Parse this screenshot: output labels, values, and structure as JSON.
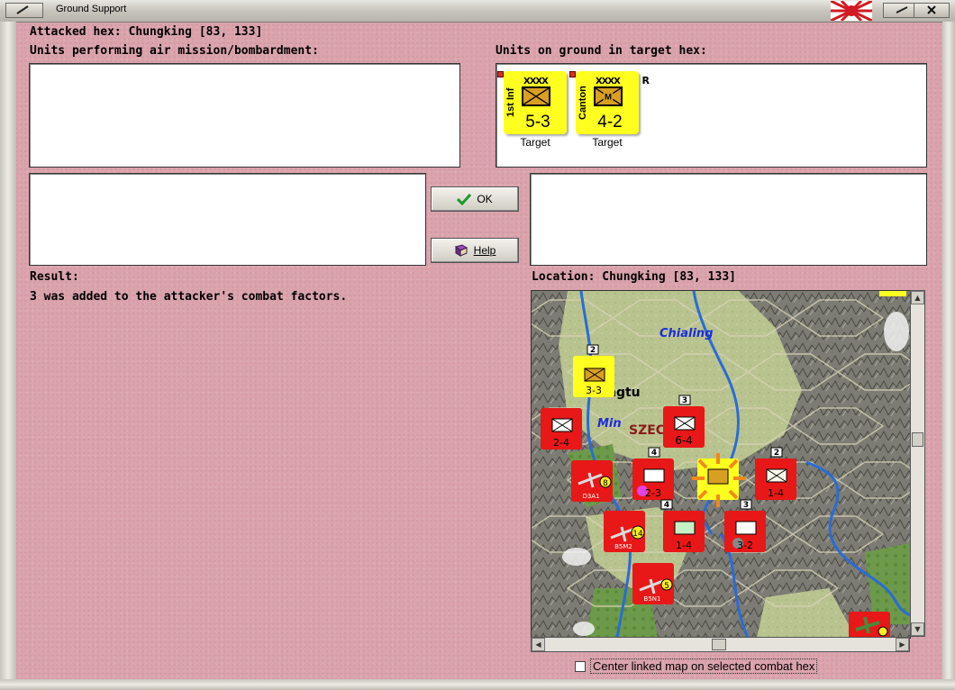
{
  "window": {
    "title": "Ground Support"
  },
  "attacked_hex": "Attacked hex: Chungking  [83, 133]",
  "air_units_label": "Units performing air mission/bombardment:",
  "ground_units_label": "Units on ground in target hex:",
  "ground_units": [
    {
      "name": "1st Inf",
      "size": "XXXX",
      "symbol": "infantry",
      "strength": "5-3",
      "status": "Target",
      "reserve": ""
    },
    {
      "name": "Canton",
      "size": "XXXX",
      "symbol": "militia",
      "symbol_letter": "M",
      "strength": "4-2",
      "status": "Target",
      "reserve": "R"
    }
  ],
  "buttons": {
    "ok_label": "OK",
    "help_label": "Help"
  },
  "result_label": "Result:",
  "result_text": "3 was added to the attacker's combat factors.",
  "location_label": "Location:  Chungking  [83, 133]",
  "map": {
    "labels": {
      "river1": "Chialing",
      "river2": "Min",
      "city1": "ngtu",
      "city2": "SZEC"
    },
    "units": [
      {
        "strength": "3-3",
        "color": "#ffff20",
        "stack": "2"
      },
      {
        "strength": "2-4",
        "color": "#e81818"
      },
      {
        "strength": "6-4",
        "color": "#e81818",
        "stack": "3"
      },
      {
        "strength": "2-3",
        "color": "#e81818",
        "stack": "4"
      },
      {
        "strength": "1-4",
        "color": "#e81818",
        "stack": "2"
      },
      {
        "strength": "1-4",
        "color": "#e81818",
        "stack": "4"
      },
      {
        "strength": "3-2",
        "color": "#e81818",
        "stack": "3"
      }
    ],
    "air_units": [
      {
        "name": "D3A1",
        "value": "8"
      },
      {
        "name": "B5M2",
        "value": "14"
      },
      {
        "name": "B5N1",
        "value": "5"
      }
    ]
  },
  "checkbox_label": "Center linked map on selected combat hex",
  "checkbox_checked": false
}
